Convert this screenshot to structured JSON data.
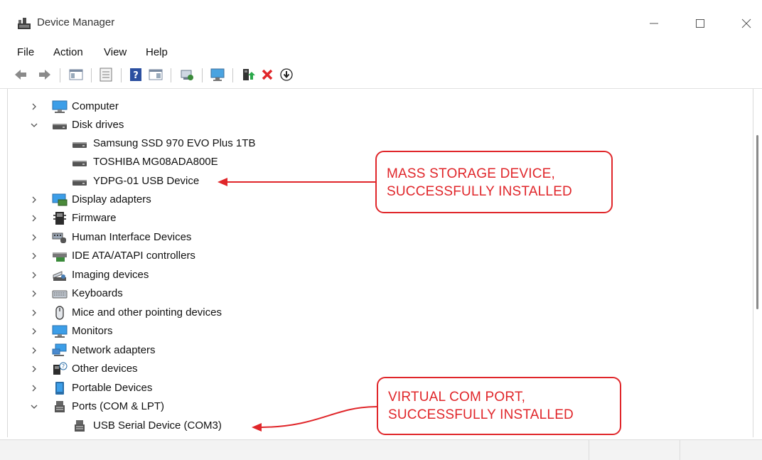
{
  "window": {
    "title": "Device Manager",
    "controls": [
      "minimize",
      "maximize",
      "close"
    ]
  },
  "menu": [
    "File",
    "Action",
    "View",
    "Help"
  ],
  "toolbar": {
    "icons": [
      "back-icon",
      "forward-icon",
      "show-hide-console-tree-icon",
      "properties-icon",
      "help-icon",
      "show-action-pane-icon",
      "scan-hardware-icon",
      "display-icon",
      "update-driver-icon",
      "uninstall-icon",
      "disable-device-icon"
    ],
    "uninstall_color": "#e0262a",
    "update_color": "#2aa84a"
  },
  "tree": [
    {
      "label": "Computer",
      "expanded": false,
      "icon": "computer-icon"
    },
    {
      "label": "Disk drives",
      "expanded": true,
      "icon": "disk-drive-icon",
      "children": [
        {
          "label": "Samsung SSD 970 EVO Plus 1TB",
          "icon": "disk-drive-icon"
        },
        {
          "label": "TOSHIBA MG08ADA800E",
          "icon": "disk-drive-icon"
        },
        {
          "label": "YDPG-01 USB Device",
          "icon": "disk-drive-icon"
        }
      ]
    },
    {
      "label": "Display adapters",
      "expanded": false,
      "icon": "display-adapter-icon"
    },
    {
      "label": "Firmware",
      "expanded": false,
      "icon": "firmware-icon"
    },
    {
      "label": "Human Interface Devices",
      "expanded": false,
      "icon": "hid-icon"
    },
    {
      "label": "IDE ATA/ATAPI controllers",
      "expanded": false,
      "icon": "ide-controller-icon"
    },
    {
      "label": "Imaging devices",
      "expanded": false,
      "icon": "imaging-icon"
    },
    {
      "label": "Keyboards",
      "expanded": false,
      "icon": "keyboard-icon"
    },
    {
      "label": "Mice and other pointing devices",
      "expanded": false,
      "icon": "mouse-icon"
    },
    {
      "label": "Monitors",
      "expanded": false,
      "icon": "monitor-icon"
    },
    {
      "label": "Network adapters",
      "expanded": false,
      "icon": "network-icon"
    },
    {
      "label": "Other devices",
      "expanded": false,
      "icon": "other-devices-icon"
    },
    {
      "label": "Portable Devices",
      "expanded": false,
      "icon": "portable-device-icon"
    },
    {
      "label": "Ports (COM & LPT)",
      "expanded": true,
      "icon": "port-icon",
      "children": [
        {
          "label": "USB Serial Device (COM3)",
          "icon": "port-icon"
        }
      ]
    }
  ],
  "callouts": {
    "mass_storage": [
      "MASS STORAGE DEVICE,",
      "SUCCESSFULLY INSTALLED"
    ],
    "virtual_com": [
      "VIRTUAL COM PORT,",
      "SUCCESSFULLY INSTALLED"
    ],
    "color": "#e0262a"
  }
}
